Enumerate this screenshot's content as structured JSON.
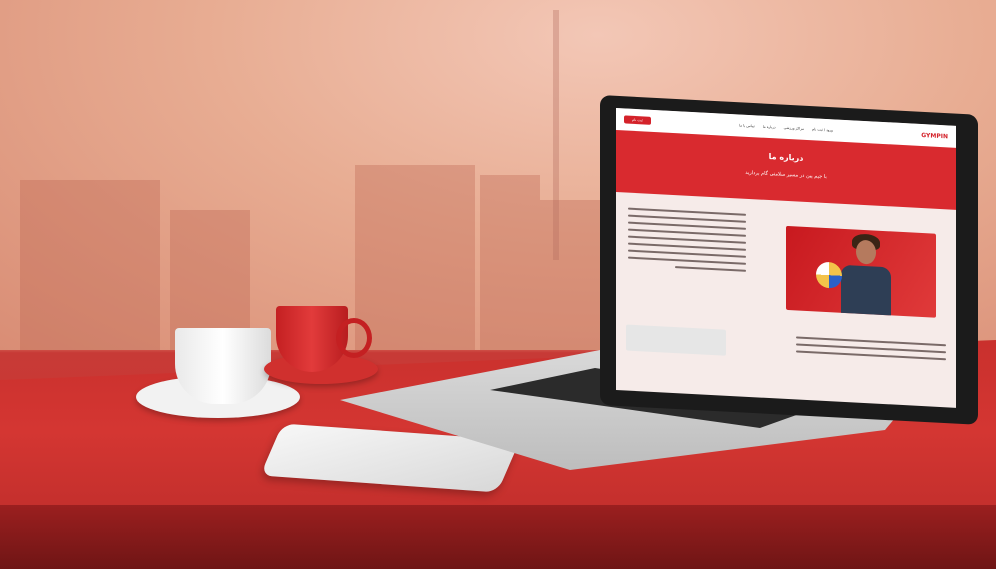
{
  "screen_site": {
    "logo_text": "GYMPIN",
    "nav_items": [
      "ورود / ثبت نام",
      "مراکز ورزشی",
      "درباره ما",
      "تماس با ما"
    ],
    "cta_label": "ثبت نام",
    "hero_title": "درباره ما",
    "hero_subtitle": "با جیم پین در مسیر سلامتی گام بردارید"
  },
  "colors": {
    "brand_red": "#d92a2f",
    "table_red": "#d43632",
    "sky": "#e8ad93"
  }
}
